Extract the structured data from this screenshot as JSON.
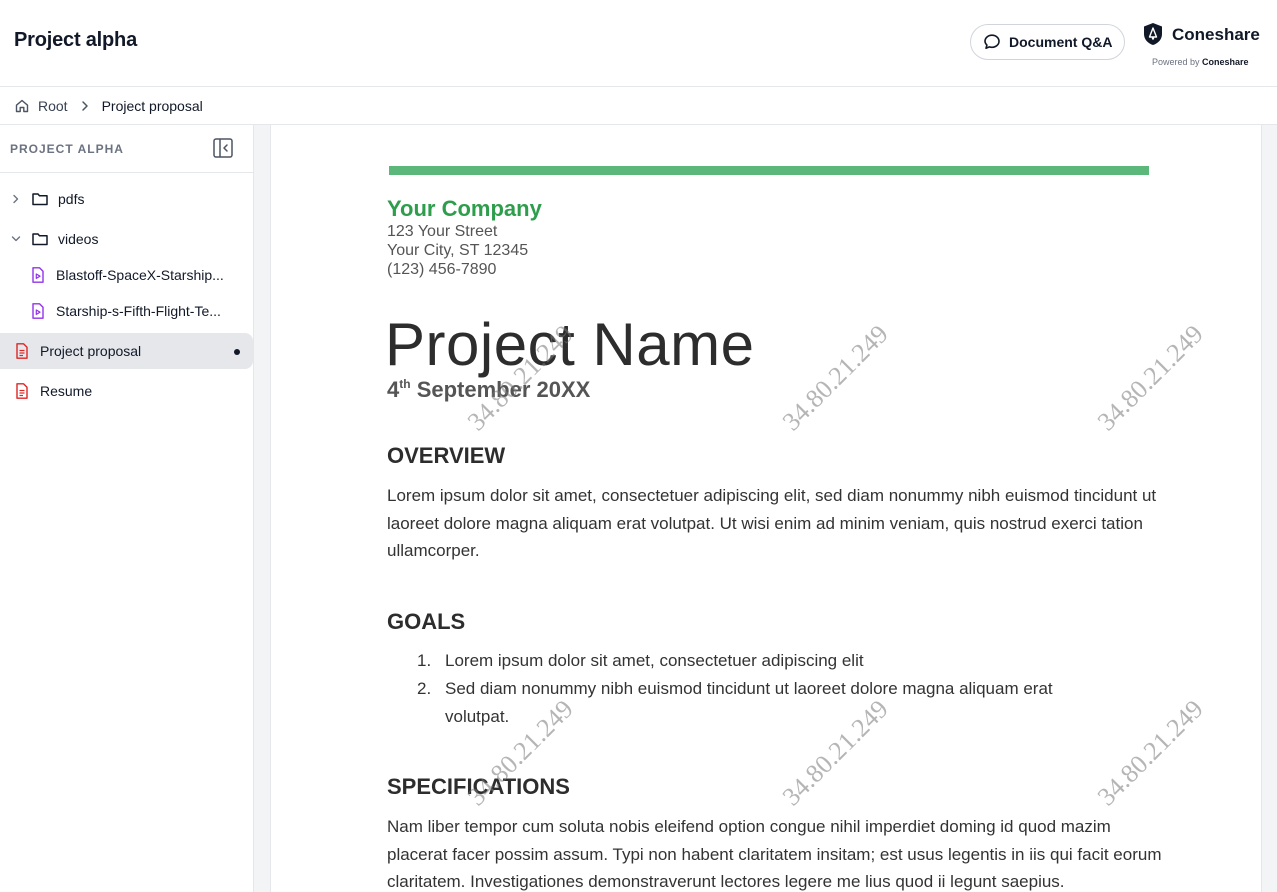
{
  "app": {
    "title": "Project alpha",
    "qa_button": "Document Q&A",
    "brand_name": "Coneshare",
    "powered_by_prefix": "Powered by",
    "powered_by_brand": "Coneshare"
  },
  "breadcrumb": {
    "root": "Root",
    "current": "Project proposal"
  },
  "sidebar": {
    "heading": "PROJECT ALPHA",
    "items": [
      {
        "label": "pdfs",
        "type": "folder",
        "expanded": false
      },
      {
        "label": "videos",
        "type": "folder",
        "expanded": true
      },
      {
        "label": "Blastoff-SpaceX-Starship...",
        "type": "video"
      },
      {
        "label": "Starship-s-Fifth-Flight-Te...",
        "type": "video"
      },
      {
        "label": "Project proposal",
        "type": "document",
        "active": true
      },
      {
        "label": "Resume",
        "type": "document"
      }
    ]
  },
  "document": {
    "company": "Your Company",
    "street": "123 Your Street",
    "city": "Your City, ST 12345",
    "phone": "(123) 456-7890",
    "project_name": "Project Name",
    "date_day": "4",
    "date_suffix": "th",
    "date_rest": " September 20XX",
    "overview_heading": "OVERVIEW",
    "overview_text": "Lorem ipsum dolor sit amet, consectetuer adipiscing elit, sed diam nonummy nibh euismod tincidunt ut laoreet dolore magna aliquam erat volutpat. Ut wisi enim ad minim veniam, quis nostrud exerci tation ullamcorper.",
    "goals_heading": "GOALS",
    "goals": [
      {
        "num": "1.",
        "text": "Lorem ipsum dolor sit amet, consectetuer adipiscing elit"
      },
      {
        "num": "2.",
        "text": "Sed diam nonummy nibh euismod tincidunt ut laoreet dolore magna aliquam erat volutpat."
      }
    ],
    "specs_heading": "SPECIFICATIONS",
    "specs_text": "Nam liber tempor cum soluta nobis eleifend option congue nihil imperdiet doming id quod mazim placerat facer possim assum. Typi non habent claritatem insitam; est usus legentis in iis qui facit eorum claritatem. Investigationes demonstraverunt lectores legere me lius quod ii legunt saepius.",
    "watermark": "34.80.21.249"
  },
  "colors": {
    "accent_green": "#5cb87a",
    "company_green": "#2e9e4d",
    "video_icon": "#9333ea",
    "doc_icon": "#dc2626"
  }
}
